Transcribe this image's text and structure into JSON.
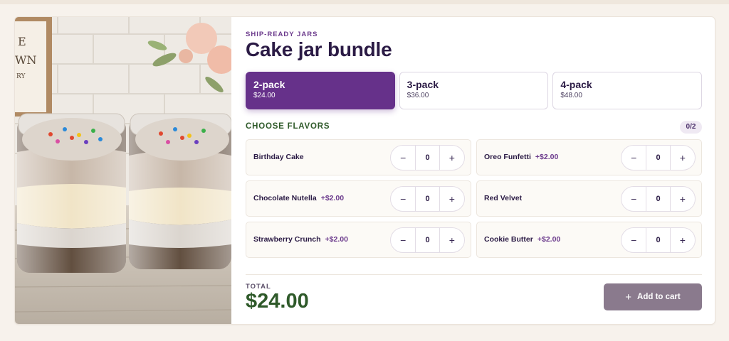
{
  "product": {
    "eyebrow": "SHIP-READY JARS",
    "title": "Cake jar bundle"
  },
  "packs": [
    {
      "label": "2-pack",
      "price": "$24.00",
      "selected": true
    },
    {
      "label": "3-pack",
      "price": "$36.00",
      "selected": false
    },
    {
      "label": "4-pack",
      "price": "$48.00",
      "selected": false
    }
  ],
  "flavors_section": {
    "heading": "CHOOSE FLAVORS",
    "count": "0/2"
  },
  "flavors": [
    {
      "name": "Birthday Cake",
      "extra": "",
      "qty": "0"
    },
    {
      "name": "Oreo Funfetti",
      "extra": "+$2.00",
      "qty": "0"
    },
    {
      "name": "Chocolate Nutella",
      "extra": "+$2.00",
      "qty": "0"
    },
    {
      "name": "Red Velvet",
      "extra": "",
      "qty": "0"
    },
    {
      "name": "Strawberry Crunch",
      "extra": "+$2.00",
      "qty": "0"
    },
    {
      "name": "Cookie Butter",
      "extra": "+$2.00",
      "qty": "0"
    }
  ],
  "stepper": {
    "decrement_symbol": "−",
    "increment_symbol": "+"
  },
  "summary": {
    "total_label": "TOTAL",
    "total_value": "$24.00",
    "add_button_label": "Add to cart",
    "add_button_icon": "plus-icon"
  },
  "colors": {
    "accent": "#66318a",
    "total_green": "#2f5a2a",
    "button_muted": "#8a7a8d"
  }
}
